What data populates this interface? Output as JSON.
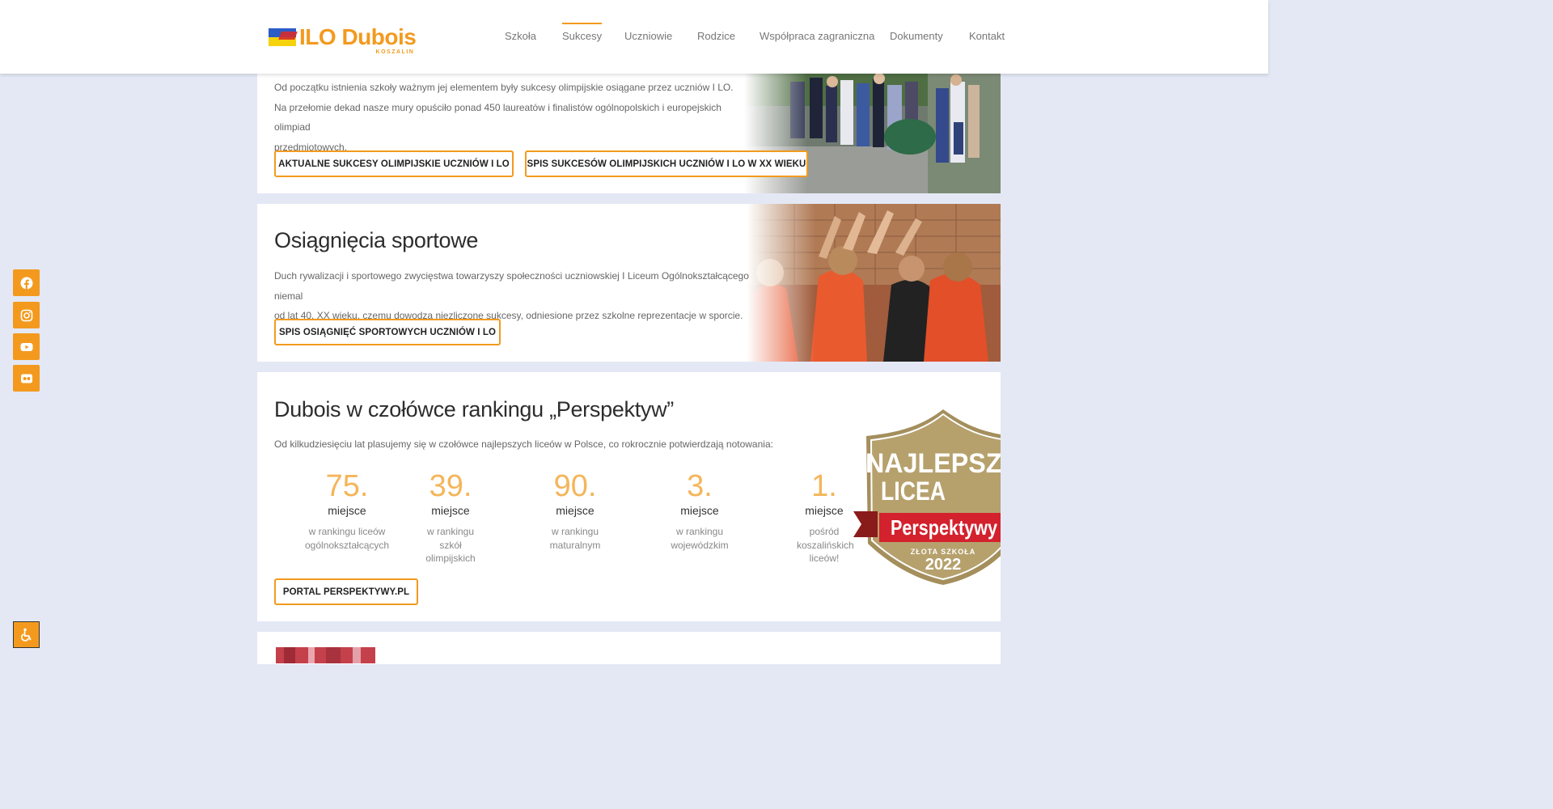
{
  "header": {
    "logo_text": "ILO Dubois",
    "logo_sub": "KOSZALIN",
    "nav": [
      {
        "label": "Szkoła",
        "active": false
      },
      {
        "label": "Sukcesy",
        "active": true
      },
      {
        "label": "Uczniowie",
        "active": false
      },
      {
        "label": "Rodzice",
        "active": false
      },
      {
        "label": "Współpraca zagraniczna",
        "active": false
      },
      {
        "label": "Dokumenty",
        "active": false
      },
      {
        "label": "Kontakt",
        "active": false
      }
    ]
  },
  "social": [
    "facebook-icon",
    "instagram-icon",
    "youtube-icon",
    "flickr-icon"
  ],
  "olympiad": {
    "line1": "Od początku istnienia szkoły ważnym jej elementem były sukcesy olimpijskie osiągane przez uczniów I LO.",
    "line2": "Na przełomie dekad nasze mury opuściło ponad 450 laureatów i finalistów ogólnopolskich i europejskich olimpiad",
    "line3": "przedmiotowych.",
    "button1": "AKTUALNE SUKCESY OLIMPIJSKIE UCZNIÓW I LO",
    "button2": "SPIS SUKCESÓW OLIMPIJSKICH UCZNIÓW I LO W XX WIEKU"
  },
  "sports": {
    "title": "Osiągnięcia sportowe",
    "line1": "Duch rywalizacji i sportowego zwycięstwa towarzyszy społeczności uczniowskiej I Liceum Ogólnokształcącego niemal",
    "line2": "od lat 40. XX wieku, czemu dowodzą niezliczone sukcesy, odniesione przez szkolne reprezentacje w sporcie.",
    "button": "SPIS OSIĄGNIĘĆ SPORTOWYCH UCZNIÓW I LO"
  },
  "ranking": {
    "title": "Dubois w czołówce rankingu „Perspektyw”",
    "intro": "Od kilkudziesięciu lat plasujemy się w czołówce najlepszych liceów w Polsce, co rokrocznie potwierdzają notowania:",
    "stats": [
      {
        "number": "75.",
        "unit": "miejsce",
        "desc": "w rankingu liceów ogólnokształcących"
      },
      {
        "number": "39.",
        "unit": "miejsce",
        "desc": "w rankingu szkół olimpijskich"
      },
      {
        "number": "90.",
        "unit": "miejsce",
        "desc": "w rankingu maturalnym"
      },
      {
        "number": "3.",
        "unit": "miejsce",
        "desc": "w rankingu wojewódzkim"
      },
      {
        "number": "1.",
        "unit": "miejsce",
        "desc": "pośród koszalińskich liceów!"
      }
    ],
    "button": "PORTAL PERSPEKTYWY.PL",
    "badge": {
      "line1": "NAJLEPSZE",
      "line2": "LICEA",
      "ribbon": "Perspektywy",
      "line3": "ZŁOTA SZKOŁA",
      "year": "2022"
    }
  },
  "colors": {
    "accent": "#f39a1e",
    "background": "#e4e8f5"
  }
}
